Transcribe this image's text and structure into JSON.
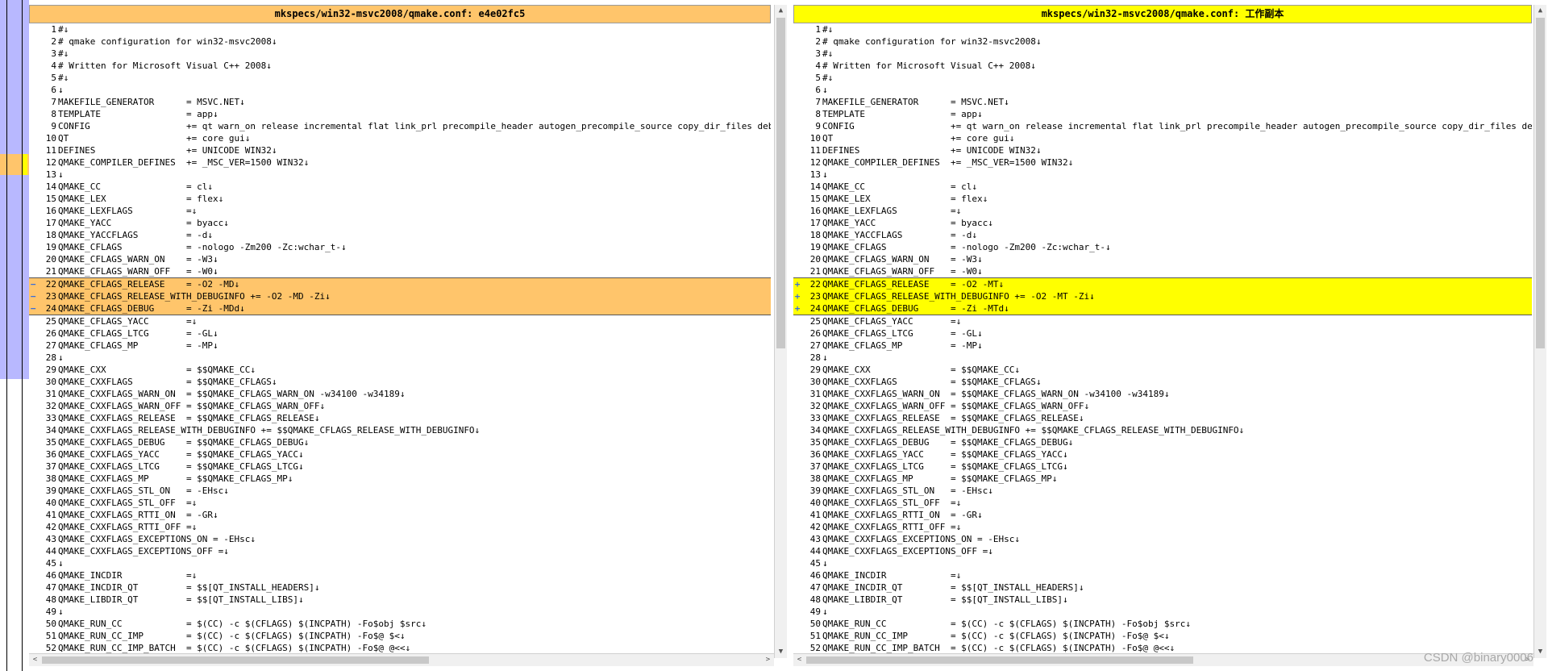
{
  "left_pane": {
    "title": "mkspecs/win32-msvc2008/qmake.conf: e4e02fc5",
    "marker": "−"
  },
  "right_pane": {
    "title": "mkspecs/win32-msvc2008/qmake.conf: 工作副本",
    "marker": "+"
  },
  "left_lines": [
    {
      "n": "1",
      "t": "#↓"
    },
    {
      "n": "2",
      "t": "# qmake configuration for win32-msvc2008↓"
    },
    {
      "n": "3",
      "t": "#↓"
    },
    {
      "n": "4",
      "t": "# Written for Microsoft Visual C++ 2008↓"
    },
    {
      "n": "5",
      "t": "#↓"
    },
    {
      "n": "6",
      "t": "↓"
    },
    {
      "n": "7",
      "t": "MAKEFILE_GENERATOR      = MSVC.NET↓"
    },
    {
      "n": "8",
      "t": "TEMPLATE                = app↓"
    },
    {
      "n": "9",
      "t": "CONFIG                  += qt warn_on release incremental flat link_prl precompile_header autogen_precompile_source copy_dir_files debug_and_release debug_and_release_target embed_manifest_dll embed_manifest_exe↓"
    },
    {
      "n": "10",
      "t": "QT                      += core gui↓"
    },
    {
      "n": "11",
      "t": "DEFINES                 += UNICODE WIN32↓"
    },
    {
      "n": "12",
      "t": "QMAKE_COMPILER_DEFINES  += _MSC_VER=1500 WIN32↓"
    },
    {
      "n": "13",
      "t": "↓"
    },
    {
      "n": "14",
      "t": "QMAKE_CC                = cl↓"
    },
    {
      "n": "15",
      "t": "QMAKE_LEX               = flex↓"
    },
    {
      "n": "16",
      "t": "QMAKE_LEXFLAGS          =↓"
    },
    {
      "n": "17",
      "t": "QMAKE_YACC              = byacc↓"
    },
    {
      "n": "18",
      "t": "QMAKE_YACCFLAGS         = -d↓"
    },
    {
      "n": "19",
      "t": "QMAKE_CFLAGS            = -nologo -Zm200 -Zc:wchar_t-↓"
    },
    {
      "n": "20",
      "t": "QMAKE_CFLAGS_WARN_ON    = -W3↓"
    },
    {
      "n": "21",
      "t": "QMAKE_CFLAGS_WARN_OFF   = -W0↓"
    },
    {
      "n": "22",
      "t": "QMAKE_CFLAGS_RELEASE    = -O2 -MD↓",
      "chg": true
    },
    {
      "n": "23",
      "t": "QMAKE_CFLAGS_RELEASE_WITH_DEBUGINFO += -O2 -MD -Zi↓",
      "chg": true
    },
    {
      "n": "24",
      "t": "QMAKE_CFLAGS_DEBUG      = -Zi -MDd↓",
      "chg": true
    },
    {
      "n": "25",
      "t": "QMAKE_CFLAGS_YACC       =↓"
    },
    {
      "n": "26",
      "t": "QMAKE_CFLAGS_LTCG       = -GL↓"
    },
    {
      "n": "27",
      "t": "QMAKE_CFLAGS_MP         = -MP↓"
    },
    {
      "n": "28",
      "t": "↓"
    },
    {
      "n": "29",
      "t": "QMAKE_CXX               = $$QMAKE_CC↓"
    },
    {
      "n": "30",
      "t": "QMAKE_CXXFLAGS          = $$QMAKE_CFLAGS↓"
    },
    {
      "n": "31",
      "t": "QMAKE_CXXFLAGS_WARN_ON  = $$QMAKE_CFLAGS_WARN_ON -w34100 -w34189↓"
    },
    {
      "n": "32",
      "t": "QMAKE_CXXFLAGS_WARN_OFF = $$QMAKE_CFLAGS_WARN_OFF↓"
    },
    {
      "n": "33",
      "t": "QMAKE_CXXFLAGS_RELEASE  = $$QMAKE_CFLAGS_RELEASE↓"
    },
    {
      "n": "34",
      "t": "QMAKE_CXXFLAGS_RELEASE_WITH_DEBUGINFO += $$QMAKE_CFLAGS_RELEASE_WITH_DEBUGINFO↓"
    },
    {
      "n": "35",
      "t": "QMAKE_CXXFLAGS_DEBUG    = $$QMAKE_CFLAGS_DEBUG↓"
    },
    {
      "n": "36",
      "t": "QMAKE_CXXFLAGS_YACC     = $$QMAKE_CFLAGS_YACC↓"
    },
    {
      "n": "37",
      "t": "QMAKE_CXXFLAGS_LTCG     = $$QMAKE_CFLAGS_LTCG↓"
    },
    {
      "n": "38",
      "t": "QMAKE_CXXFLAGS_MP       = $$QMAKE_CFLAGS_MP↓"
    },
    {
      "n": "39",
      "t": "QMAKE_CXXFLAGS_STL_ON   = -EHsc↓"
    },
    {
      "n": "40",
      "t": "QMAKE_CXXFLAGS_STL_OFF  =↓"
    },
    {
      "n": "41",
      "t": "QMAKE_CXXFLAGS_RTTI_ON  = -GR↓"
    },
    {
      "n": "42",
      "t": "QMAKE_CXXFLAGS_RTTI_OFF =↓"
    },
    {
      "n": "43",
      "t": "QMAKE_CXXFLAGS_EXCEPTIONS_ON = -EHsc↓"
    },
    {
      "n": "44",
      "t": "QMAKE_CXXFLAGS_EXCEPTIONS_OFF =↓"
    },
    {
      "n": "45",
      "t": "↓"
    },
    {
      "n": "46",
      "t": "QMAKE_INCDIR            =↓"
    },
    {
      "n": "47",
      "t": "QMAKE_INCDIR_QT         = $$[QT_INSTALL_HEADERS]↓"
    },
    {
      "n": "48",
      "t": "QMAKE_LIBDIR_QT         = $$[QT_INSTALL_LIBS]↓"
    },
    {
      "n": "49",
      "t": "↓"
    },
    {
      "n": "50",
      "t": "QMAKE_RUN_CC            = $(CC) -c $(CFLAGS) $(INCPATH) -Fo$obj $src↓"
    },
    {
      "n": "51",
      "t": "QMAKE_RUN_CC_IMP        = $(CC) -c $(CFLAGS) $(INCPATH) -Fo$@ $<↓"
    },
    {
      "n": "52",
      "t": "QMAKE_RUN_CC_IMP_BATCH  = $(CC) -c $(CFLAGS) $(INCPATH) -Fo$@ @<<↓"
    }
  ],
  "right_lines": [
    {
      "n": "1",
      "t": "#↓"
    },
    {
      "n": "2",
      "t": "# qmake configuration for win32-msvc2008↓"
    },
    {
      "n": "3",
      "t": "#↓"
    },
    {
      "n": "4",
      "t": "# Written for Microsoft Visual C++ 2008↓"
    },
    {
      "n": "5",
      "t": "#↓"
    },
    {
      "n": "6",
      "t": "↓"
    },
    {
      "n": "7",
      "t": "MAKEFILE_GENERATOR      = MSVC.NET↓"
    },
    {
      "n": "8",
      "t": "TEMPLATE                = app↓"
    },
    {
      "n": "9",
      "t": "CONFIG                  += qt warn_on release incremental flat link_prl precompile_header autogen_precompile_source copy_dir_files debug_and_release debug_and_release_target embed_manifest_dll embed_manifest_exe↓"
    },
    {
      "n": "10",
      "t": "QT                      += core gui↓"
    },
    {
      "n": "11",
      "t": "DEFINES                 += UNICODE WIN32↓"
    },
    {
      "n": "12",
      "t": "QMAKE_COMPILER_DEFINES  += _MSC_VER=1500 WIN32↓"
    },
    {
      "n": "13",
      "t": "↓"
    },
    {
      "n": "14",
      "t": "QMAKE_CC                = cl↓"
    },
    {
      "n": "15",
      "t": "QMAKE_LEX               = flex↓"
    },
    {
      "n": "16",
      "t": "QMAKE_LEXFLAGS          =↓"
    },
    {
      "n": "17",
      "t": "QMAKE_YACC              = byacc↓"
    },
    {
      "n": "18",
      "t": "QMAKE_YACCFLAGS         = -d↓"
    },
    {
      "n": "19",
      "t": "QMAKE_CFLAGS            = -nologo -Zm200 -Zc:wchar_t-↓"
    },
    {
      "n": "20",
      "t": "QMAKE_CFLAGS_WARN_ON    = -W3↓"
    },
    {
      "n": "21",
      "t": "QMAKE_CFLAGS_WARN_OFF   = -W0↓"
    },
    {
      "n": "22",
      "t": "QMAKE_CFLAGS_RELEASE    = -O2 -MT↓",
      "chg": true
    },
    {
      "n": "23",
      "t": "QMAKE_CFLAGS_RELEASE_WITH_DEBUGINFO += -O2 -MT -Zi↓",
      "chg": true
    },
    {
      "n": "24",
      "t": "QMAKE_CFLAGS_DEBUG      = -Zi -MTd↓",
      "chg": true
    },
    {
      "n": "25",
      "t": "QMAKE_CFLAGS_YACC       =↓"
    },
    {
      "n": "26",
      "t": "QMAKE_CFLAGS_LTCG       = -GL↓"
    },
    {
      "n": "27",
      "t": "QMAKE_CFLAGS_MP         = -MP↓"
    },
    {
      "n": "28",
      "t": "↓"
    },
    {
      "n": "29",
      "t": "QMAKE_CXX               = $$QMAKE_CC↓"
    },
    {
      "n": "30",
      "t": "QMAKE_CXXFLAGS          = $$QMAKE_CFLAGS↓"
    },
    {
      "n": "31",
      "t": "QMAKE_CXXFLAGS_WARN_ON  = $$QMAKE_CFLAGS_WARN_ON -w34100 -w34189↓"
    },
    {
      "n": "32",
      "t": "QMAKE_CXXFLAGS_WARN_OFF = $$QMAKE_CFLAGS_WARN_OFF↓"
    },
    {
      "n": "33",
      "t": "QMAKE_CXXFLAGS_RELEASE  = $$QMAKE_CFLAGS_RELEASE↓"
    },
    {
      "n": "34",
      "t": "QMAKE_CXXFLAGS_RELEASE_WITH_DEBUGINFO += $$QMAKE_CFLAGS_RELEASE_WITH_DEBUGINFO↓"
    },
    {
      "n": "35",
      "t": "QMAKE_CXXFLAGS_DEBUG    = $$QMAKE_CFLAGS_DEBUG↓"
    },
    {
      "n": "36",
      "t": "QMAKE_CXXFLAGS_YACC     = $$QMAKE_CFLAGS_YACC↓"
    },
    {
      "n": "37",
      "t": "QMAKE_CXXFLAGS_LTCG     = $$QMAKE_CFLAGS_LTCG↓"
    },
    {
      "n": "38",
      "t": "QMAKE_CXXFLAGS_MP       = $$QMAKE_CFLAGS_MP↓"
    },
    {
      "n": "39",
      "t": "QMAKE_CXXFLAGS_STL_ON   = -EHsc↓"
    },
    {
      "n": "40",
      "t": "QMAKE_CXXFLAGS_STL_OFF  =↓"
    },
    {
      "n": "41",
      "t": "QMAKE_CXXFLAGS_RTTI_ON  = -GR↓"
    },
    {
      "n": "42",
      "t": "QMAKE_CXXFLAGS_RTTI_OFF =↓"
    },
    {
      "n": "43",
      "t": "QMAKE_CXXFLAGS_EXCEPTIONS_ON = -EHsc↓"
    },
    {
      "n": "44",
      "t": "QMAKE_CXXFLAGS_EXCEPTIONS_OFF =↓"
    },
    {
      "n": "45",
      "t": "↓"
    },
    {
      "n": "46",
      "t": "QMAKE_INCDIR            =↓"
    },
    {
      "n": "47",
      "t": "QMAKE_INCDIR_QT         = $$[QT_INSTALL_HEADERS]↓"
    },
    {
      "n": "48",
      "t": "QMAKE_LIBDIR_QT         = $$[QT_INSTALL_LIBS]↓"
    },
    {
      "n": "49",
      "t": "↓"
    },
    {
      "n": "50",
      "t": "QMAKE_RUN_CC            = $(CC) -c $(CFLAGS) $(INCPATH) -Fo$obj $src↓"
    },
    {
      "n": "51",
      "t": "QMAKE_RUN_CC_IMP        = $(CC) -c $(CFLAGS) $(INCPATH) -Fo$@ $<↓"
    },
    {
      "n": "52",
      "t": "QMAKE_RUN_CC_IMP_BATCH  = $(CC) -c $(CFLAGS) $(INCPATH) -Fo$@ @<<↓"
    }
  ],
  "scroll_icons": {
    "up": "▲",
    "down": "▼",
    "left": "<",
    "right": ">"
  },
  "watermark": "CSDN @binary0006",
  "colors": {
    "left_change_bg": "#ffc56b",
    "right_change_bg": "#ffff00",
    "locator_lane": "#b8b8ff"
  }
}
